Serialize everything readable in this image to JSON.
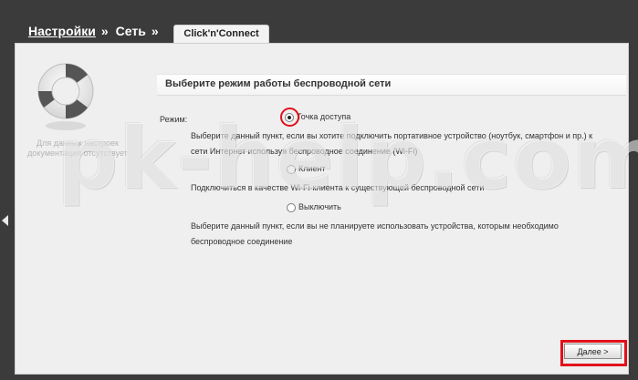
{
  "breadcrumb": {
    "item1": "Настройки",
    "sep1": "»",
    "item2": "Сеть",
    "sep2": "»"
  },
  "tab": {
    "label": "Click'n'Connect"
  },
  "help": {
    "text": "Для данных настроек документация отсутствует"
  },
  "section": {
    "title": "Выберите режим работы беспроводной сети"
  },
  "mode": {
    "label": "Режим:",
    "options": [
      {
        "label": "Точка доступа",
        "selected": true,
        "description": "Выберите данный пункт, если вы хотите подключить портативное устройство (ноутбук, смартфон и пр.) к сети Интернет используя беспроводное соединение (Wi-Fi)"
      },
      {
        "label": "Клиент",
        "selected": false,
        "description": "Подключиться в качестве Wi-Fi-клиента к существующей беспроводной сети"
      },
      {
        "label": "Выключить",
        "selected": false,
        "description": "Выберите данный пункт, если вы не планируете использовать устройства, которым необходимо беспроводное соединение"
      }
    ]
  },
  "buttons": {
    "next_label": "Далее >"
  },
  "watermark": {
    "text": "pk-help.com"
  },
  "colors": {
    "highlight": "#e2101a",
    "background": "#3b3b3b",
    "panel": "#efefef"
  }
}
